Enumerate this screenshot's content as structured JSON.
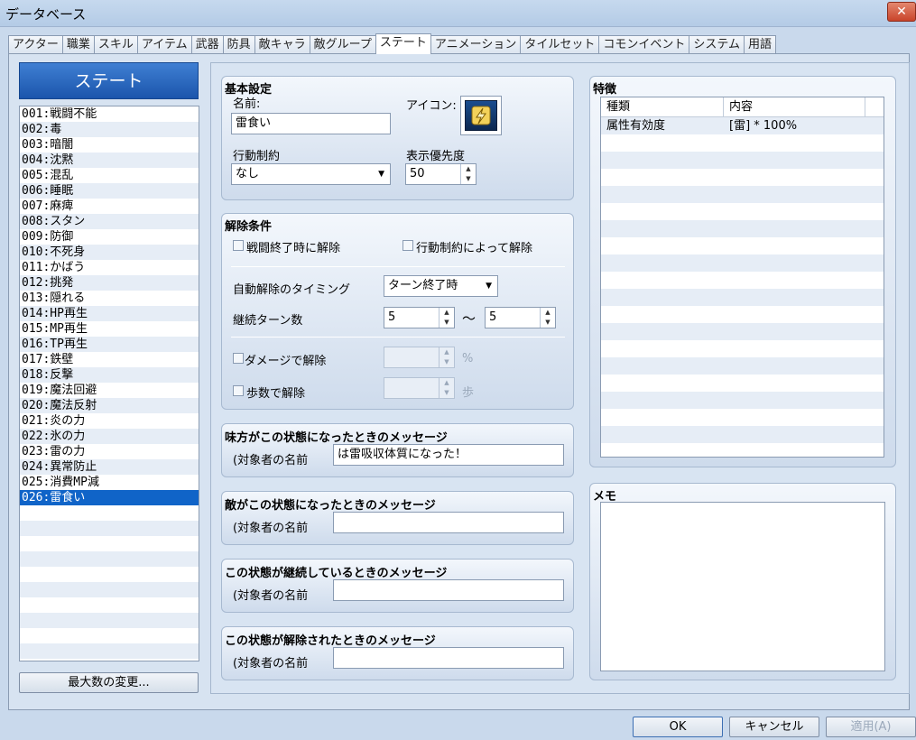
{
  "window": {
    "title": "データベース",
    "close_label": "✕"
  },
  "tabs": [
    "アクター",
    "職業",
    "スキル",
    "アイテム",
    "武器",
    "防具",
    "敵キャラ",
    "敵グループ",
    "ステート",
    "アニメーション",
    "タイルセット",
    "コモンイベント",
    "システム",
    "用語"
  ],
  "active_tab_index": 8,
  "left": {
    "header": "ステート",
    "items": [
      "001:戦闘不能",
      "002:毒",
      "003:暗闇",
      "004:沈黙",
      "005:混乱",
      "006:睡眠",
      "007:麻痺",
      "008:スタン",
      "009:防御",
      "010:不死身",
      "011:かばう",
      "012:挑発",
      "013:隠れる",
      "014:HP再生",
      "015:MP再生",
      "016:TP再生",
      "017:鉄壁",
      "018:反撃",
      "019:魔法回避",
      "020:魔法反射",
      "021:炎の力",
      "022:氷の力",
      "023:雷の力",
      "024:異常防止",
      "025:消費MP減",
      "026:雷食い"
    ],
    "selected_index": 25,
    "max_button": "最大数の変更..."
  },
  "basic": {
    "title": "基本設定",
    "name_label": "名前:",
    "name_value": "雷食い",
    "icon_label": "アイコン:",
    "icon_name": "lightning-icon",
    "restriction_label": "行動制約",
    "restriction_value": "なし",
    "priority_label": "表示優先度",
    "priority_value": "50"
  },
  "removal": {
    "title": "解除条件",
    "battle_end_label": "戦闘終了時に解除",
    "by_restriction_label": "行動制約によって解除",
    "timing_label": "自動解除のタイミング",
    "timing_value": "ターン終了時",
    "turns_label": "継続ターン数",
    "turns_min": "5",
    "turns_max": "5",
    "tilde": "〜",
    "damage_label": "ダメージで解除",
    "damage_unit": "%",
    "steps_label": "歩数で解除",
    "steps_unit": "歩"
  },
  "messages": [
    {
      "title": "味方がこの状態になったときのメッセージ",
      "prefix": "(対象者の名前",
      "value": "は雷吸収体質になった！"
    },
    {
      "title": "敵がこの状態になったときのメッセージ",
      "prefix": "(対象者の名前",
      "value": ""
    },
    {
      "title": "この状態が継続しているときのメッセージ",
      "prefix": "(対象者の名前",
      "value": ""
    },
    {
      "title": "この状態が解除されたときのメッセージ",
      "prefix": "(対象者の名前",
      "value": ""
    }
  ],
  "traits": {
    "title": "特徴",
    "col_type": "種類",
    "col_content": "内容",
    "rows": [
      {
        "type": "属性有効度",
        "content": "[雷] * 100%"
      }
    ]
  },
  "memo": {
    "title": "メモ",
    "value": ""
  },
  "buttons": {
    "ok": "OK",
    "cancel": "キャンセル",
    "apply": "適用(A)"
  }
}
